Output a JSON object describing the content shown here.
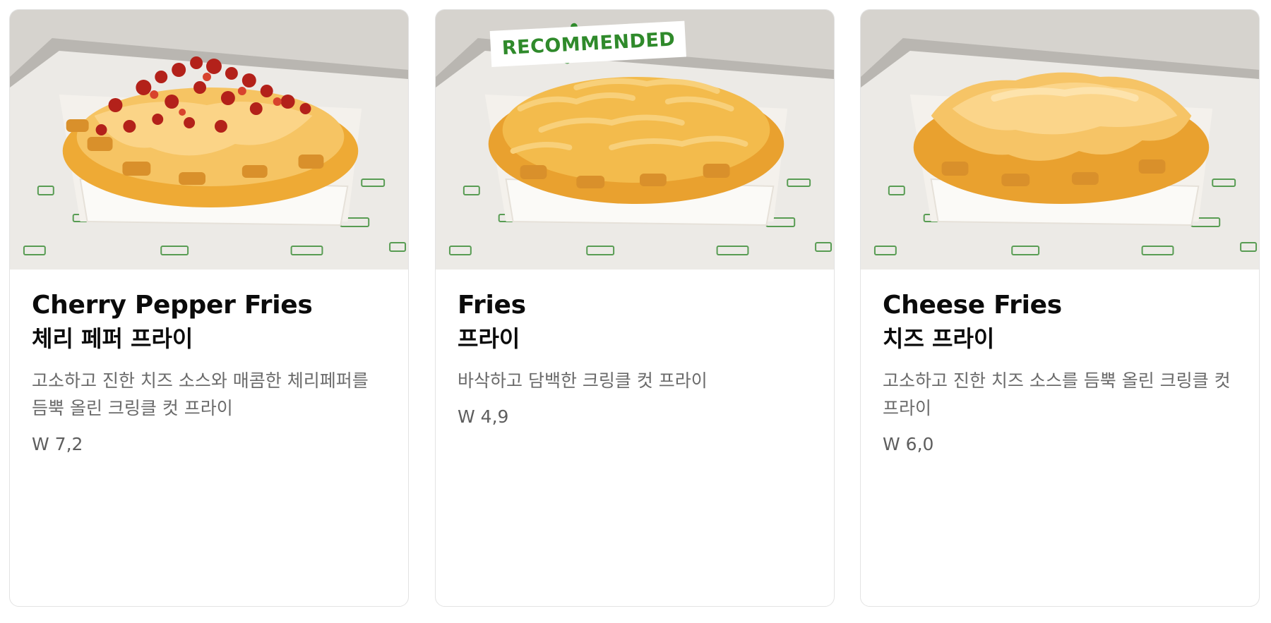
{
  "products": [
    {
      "name_en": "Cherry Pepper Fries",
      "name_ko": "체리 페퍼 프라이",
      "description": "고소하고 진한 치즈 소스와 매콤한 체리페퍼를 듬뿍 올린 크링클 컷 프라이",
      "price": "W 7,2",
      "topping": "cherry-pepper-and-cheese",
      "recommended": false
    },
    {
      "name_en": "Fries",
      "name_ko": "프라이",
      "description": "바삭하고 담백한 크링클 컷 프라이",
      "price": "W 4,9",
      "topping": "plain",
      "recommended": true
    },
    {
      "name_en": "Cheese Fries",
      "name_ko": "치즈 프라이",
      "description": "고소하고 진한 치즈 소스를 듬뿍 올린 크링클 컷 프라이",
      "price": "W 6,0",
      "topping": "cheese",
      "recommended": false
    }
  ],
  "badge": {
    "label": "RECOMMENDED",
    "color": "#2f8a2b"
  },
  "colors": {
    "brand_green": "#2f8a2b",
    "fries": "#f0b53c",
    "cheese": "#f8c560",
    "cherry_pepper": "#b3211a"
  }
}
